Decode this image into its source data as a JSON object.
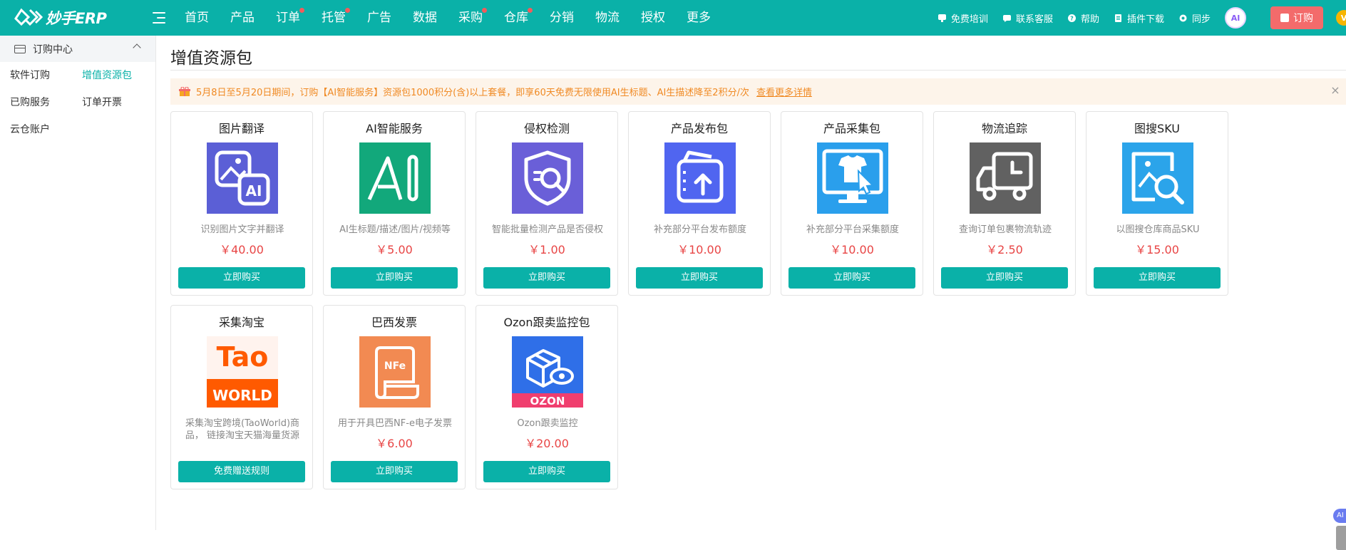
{
  "brand": {
    "name": "妙手ERP",
    "accent": "#0ab1a8"
  },
  "nav": {
    "items": [
      {
        "label": "首页",
        "dot": false
      },
      {
        "label": "产品",
        "dot": false
      },
      {
        "label": "订单",
        "dot": true
      },
      {
        "label": "托管",
        "dot": true
      },
      {
        "label": "广告",
        "dot": false
      },
      {
        "label": "数据",
        "dot": false
      },
      {
        "label": "采购",
        "dot": true
      },
      {
        "label": "仓库",
        "dot": true
      },
      {
        "label": "分销",
        "dot": false
      },
      {
        "label": "物流",
        "dot": false
      },
      {
        "label": "授权",
        "dot": false
      },
      {
        "label": "更多",
        "dot": false
      }
    ],
    "tools": [
      {
        "label": "免费培训",
        "icon": "training-icon"
      },
      {
        "label": "联系客服",
        "icon": "chat-icon"
      },
      {
        "label": "帮助",
        "icon": "help-icon"
      },
      {
        "label": "插件下载",
        "icon": "plugin-icon"
      },
      {
        "label": "同步",
        "icon": "sync-icon"
      }
    ],
    "ai_avatar": "AI",
    "order_button": "订购",
    "vip_badge": "V"
  },
  "sidebar": {
    "header": "订购中心",
    "items": [
      {
        "label": "软件订购",
        "active": false
      },
      {
        "label": "增值资源包",
        "active": true
      },
      {
        "label": "已购服务",
        "active": false
      },
      {
        "label": "订单开票",
        "active": false
      },
      {
        "label": "云仓账户",
        "active": false
      }
    ]
  },
  "main": {
    "title": "增值资源包",
    "notice": {
      "text": "5月8日至5月20日期间，订购【AI智能服务】资源包1000积分(含)以上套餐，即享60天免费无限使用AI生标题、AI生描述降至2积分/次",
      "link": "查看更多详情"
    },
    "packages": [
      {
        "title": "图片翻译",
        "desc": "识别图片文字并翻译",
        "price": "￥40.00",
        "button": "立即购买",
        "icon": "image-translate-icon",
        "color": "#5b5fd6"
      },
      {
        "title": "AI智能服务",
        "desc": "AI生标题/描述/图片/视频等",
        "price": "￥5.00",
        "button": "立即购买",
        "icon": "ai-icon",
        "color": "#12a87b"
      },
      {
        "title": "侵权检测",
        "desc": "智能批量检测产品是否侵权",
        "price": "￥1.00",
        "button": "立即购买",
        "icon": "shield-search-icon",
        "color": "#6a5fd8"
      },
      {
        "title": "产品发布包",
        "desc": "补充部分平台发布额度",
        "price": "￥10.00",
        "button": "立即购买",
        "icon": "upload-package-icon",
        "color": "#5065f0"
      },
      {
        "title": "产品采集包",
        "desc": "补充部分平台采集额度",
        "price": "￥10.00",
        "button": "立即购买",
        "icon": "collect-monitor-icon",
        "color": "#2a9fec"
      },
      {
        "title": "物流追踪",
        "desc": "查询订单包裹物流轨迹",
        "price": "￥2.50",
        "button": "立即购买",
        "icon": "truck-icon",
        "color": "#616161"
      },
      {
        "title": "图搜SKU",
        "desc": "以图搜仓库商品SKU",
        "price": "￥15.00",
        "button": "立即购买",
        "icon": "image-search-icon",
        "color": "#2ba4ea"
      },
      {
        "title": "采集淘宝",
        "desc": "采集淘宝跨境(TaoWorld)商品， 链接淘宝天猫海量货源",
        "price": "",
        "button": "免费赠送规则",
        "icon": "taoworld-logo",
        "color": "#ff5a00",
        "logo_text": {
          "top": "Tao",
          "bottom": "WORLD"
        }
      },
      {
        "title": "巴西发票",
        "desc": "用于开具巴西NF-e电子发票",
        "price": "￥6.00",
        "button": "立即购买",
        "icon": "invoice-icon",
        "color": "#f28a52",
        "logo_text": {
          "top": "NFe"
        }
      },
      {
        "title": "Ozon跟卖监控包",
        "desc": "Ozon跟卖监控",
        "price": "￥20.00",
        "button": "立即购买",
        "icon": "ozon-monitor-icon",
        "color": "#2f6fe8",
        "logo_text": {
          "bottom": "OZON"
        }
      }
    ]
  },
  "floating": {
    "ai_label": "AI"
  }
}
